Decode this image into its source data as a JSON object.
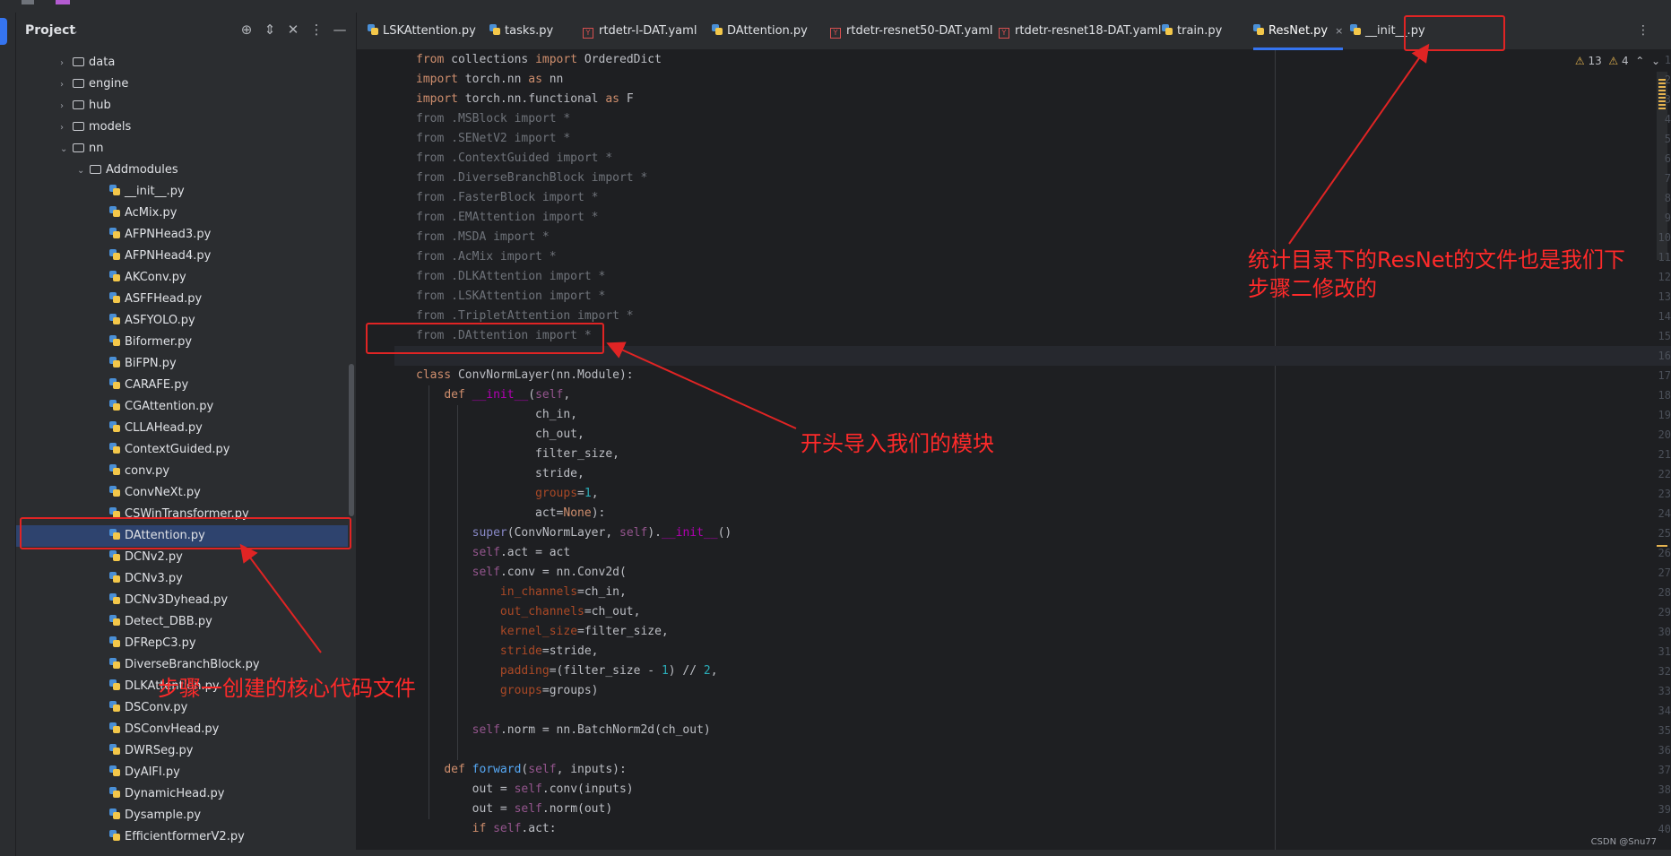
{
  "project_panel": {
    "title": "Project",
    "tree": [
      {
        "label": "data",
        "type": "folder",
        "depth": 1,
        "expanded": false
      },
      {
        "label": "engine",
        "type": "folder",
        "depth": 1,
        "expanded": false
      },
      {
        "label": "hub",
        "type": "folder",
        "depth": 1,
        "expanded": false
      },
      {
        "label": "models",
        "type": "folder",
        "depth": 1,
        "expanded": false
      },
      {
        "label": "nn",
        "type": "folder",
        "depth": 1,
        "expanded": true
      },
      {
        "label": "Addmodules",
        "type": "folder",
        "depth": 2,
        "expanded": true
      },
      {
        "label": "__init__.py",
        "type": "py",
        "depth": 3
      },
      {
        "label": "AcMix.py",
        "type": "py",
        "depth": 3
      },
      {
        "label": "AFPNHead3.py",
        "type": "py",
        "depth": 3
      },
      {
        "label": "AFPNHead4.py",
        "type": "py",
        "depth": 3
      },
      {
        "label": "AKConv.py",
        "type": "py",
        "depth": 3
      },
      {
        "label": "ASFFHead.py",
        "type": "py",
        "depth": 3
      },
      {
        "label": "ASFYOLO.py",
        "type": "py",
        "depth": 3
      },
      {
        "label": "Biformer.py",
        "type": "py",
        "depth": 3
      },
      {
        "label": "BiFPN.py",
        "type": "py",
        "depth": 3
      },
      {
        "label": "CARAFE.py",
        "type": "py",
        "depth": 3
      },
      {
        "label": "CGAttention.py",
        "type": "py",
        "depth": 3
      },
      {
        "label": "CLLAHead.py",
        "type": "py",
        "depth": 3
      },
      {
        "label": "ContextGuided.py",
        "type": "py",
        "depth": 3
      },
      {
        "label": "conv.py",
        "type": "py",
        "depth": 3
      },
      {
        "label": "ConvNeXt.py",
        "type": "py",
        "depth": 3
      },
      {
        "label": "CSWinTransformer.py",
        "type": "py",
        "depth": 3
      },
      {
        "label": "DAttention.py",
        "type": "py",
        "depth": 3,
        "selected": true
      },
      {
        "label": "DCNv2.py",
        "type": "py",
        "depth": 3
      },
      {
        "label": "DCNv3.py",
        "type": "py",
        "depth": 3
      },
      {
        "label": "DCNv3Dyhead.py",
        "type": "py",
        "depth": 3
      },
      {
        "label": "Detect_DBB.py",
        "type": "py",
        "depth": 3
      },
      {
        "label": "DFRepC3.py",
        "type": "py",
        "depth": 3
      },
      {
        "label": "DiverseBranchBlock.py",
        "type": "py",
        "depth": 3
      },
      {
        "label": "DLKAttention.py",
        "type": "py",
        "depth": 3
      },
      {
        "label": "DSConv.py",
        "type": "py",
        "depth": 3
      },
      {
        "label": "DSConvHead.py",
        "type": "py",
        "depth": 3
      },
      {
        "label": "DWRSeg.py",
        "type": "py",
        "depth": 3
      },
      {
        "label": "DyAIFI.py",
        "type": "py",
        "depth": 3
      },
      {
        "label": "DynamicHead.py",
        "type": "py",
        "depth": 3
      },
      {
        "label": "Dysample.py",
        "type": "py",
        "depth": 3
      },
      {
        "label": "EfficientformerV2.py",
        "type": "py",
        "depth": 3
      }
    ]
  },
  "tabs": [
    {
      "label": "LSKAttention.py",
      "type": "py"
    },
    {
      "label": "tasks.py",
      "type": "py"
    },
    {
      "label": "rtdetr-l-DAT.yaml",
      "type": "yaml"
    },
    {
      "label": "DAttention.py",
      "type": "py"
    },
    {
      "label": "rtdetr-resnet50-DAT.yaml",
      "type": "yaml"
    },
    {
      "label": "rtdetr-resnet18-DAT.yaml",
      "type": "yaml"
    },
    {
      "label": "train.py",
      "type": "py"
    },
    {
      "label": "ResNet.py",
      "type": "py",
      "active": true
    },
    {
      "label": "__init__.py",
      "type": "py"
    }
  ],
  "inspections": {
    "warnings": "13",
    "weak_warnings": "4"
  },
  "code_lines": [
    "from collections import OrderedDict",
    "import torch.nn as nn",
    "import torch.nn.functional as F",
    "from .MSBlock import *",
    "from .SENetV2 import *",
    "from .ContextGuided import *",
    "from .DiverseBranchBlock import *",
    "from .FasterBlock import *",
    "from .EMAttention import *",
    "from .MSDA import *",
    "from .AcMix import *",
    "from .DLKAttention import *",
    "from .LSKAttention import *",
    "from .TripletAttention import *",
    "from .DAttention import *",
    "",
    "class ConvNormLayer(nn.Module):",
    "    def __init__(self,",
    "                 ch_in,",
    "                 ch_out,",
    "                 filter_size,",
    "                 stride,",
    "                 groups=1,",
    "                 act=None):",
    "        super(ConvNormLayer, self).__init__()",
    "        self.act = act",
    "        self.conv = nn.Conv2d(",
    "            in_channels=ch_in,",
    "            out_channels=ch_out,",
    "            kernel_size=filter_size,",
    "            stride=stride,",
    "            padding=(filter_size - 1) // 2,",
    "            groups=groups)",
    "",
    "        self.norm = nn.BatchNorm2d(ch_out)",
    "",
    "    def forward(self, inputs):",
    "        out = self.conv(inputs)",
    "        out = self.norm(out)",
    "        if self.act:"
  ],
  "annotations": {
    "note_resnet_line1": "统计目录下的ResNet的文件也是我们下",
    "note_resnet_line2": "步骤二修改的",
    "note_import": "开头导入我们的模块",
    "note_core_file": "步骤一创建的核心代码文件"
  },
  "watermark": "CSDN @Snu77",
  "colors": {
    "annotation_red": "#ff2a2a",
    "selection_blue": "#2e436e",
    "accent": "#3574f0"
  }
}
